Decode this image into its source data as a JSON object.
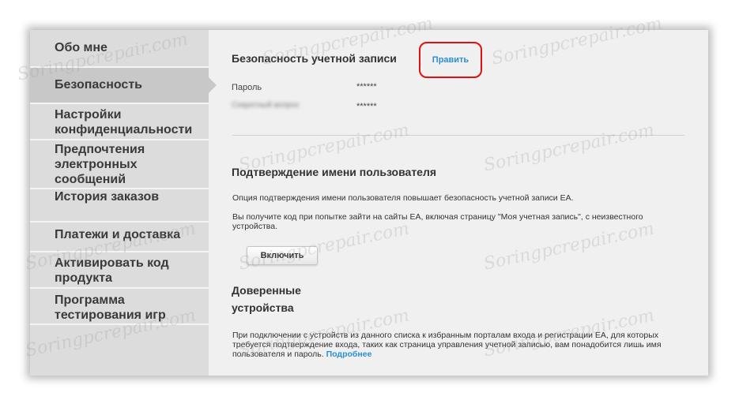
{
  "sidebar": {
    "items": [
      {
        "label": "Обо мне"
      },
      {
        "label": "Безопасность"
      },
      {
        "label": "Настройки конфиденциальности"
      },
      {
        "label": "Предпочтения электронных сообщений"
      },
      {
        "label": "История заказов"
      },
      {
        "label": "Платежи и доставка"
      },
      {
        "label": "Активировать код продукта"
      },
      {
        "label": "Программа тестирования игр"
      }
    ]
  },
  "account_security": {
    "title": "Безопасность учетной записи",
    "edit_label": "Править",
    "password_label": "Пароль",
    "password_value": "******",
    "blurred_label": "Секретный вопрос",
    "blurred_value": "******"
  },
  "username_verification": {
    "title": "Подтверждение имени пользователя",
    "description": "Опция подтверждения имени пользователя повышает безопасность учетной записи EA.",
    "note": "Вы получите код при попытке зайти на сайты EA, включая страницу \"Моя учетная запись\", с неизвестного устройства.",
    "enable_label": "Включить"
  },
  "trusted_devices": {
    "title_line1": "Доверенные",
    "title_line2": "устройства",
    "text": "При подключении с устройств из данного списка к избранным порталам входа и регистрации EA, для которых требуется подтверждение входа, таких как страница управления учетной записью, вам понадобится лишь имя пользователя и пароль.",
    "more_label": "Подробнее"
  },
  "watermark": "Soringpcrepair.com"
}
